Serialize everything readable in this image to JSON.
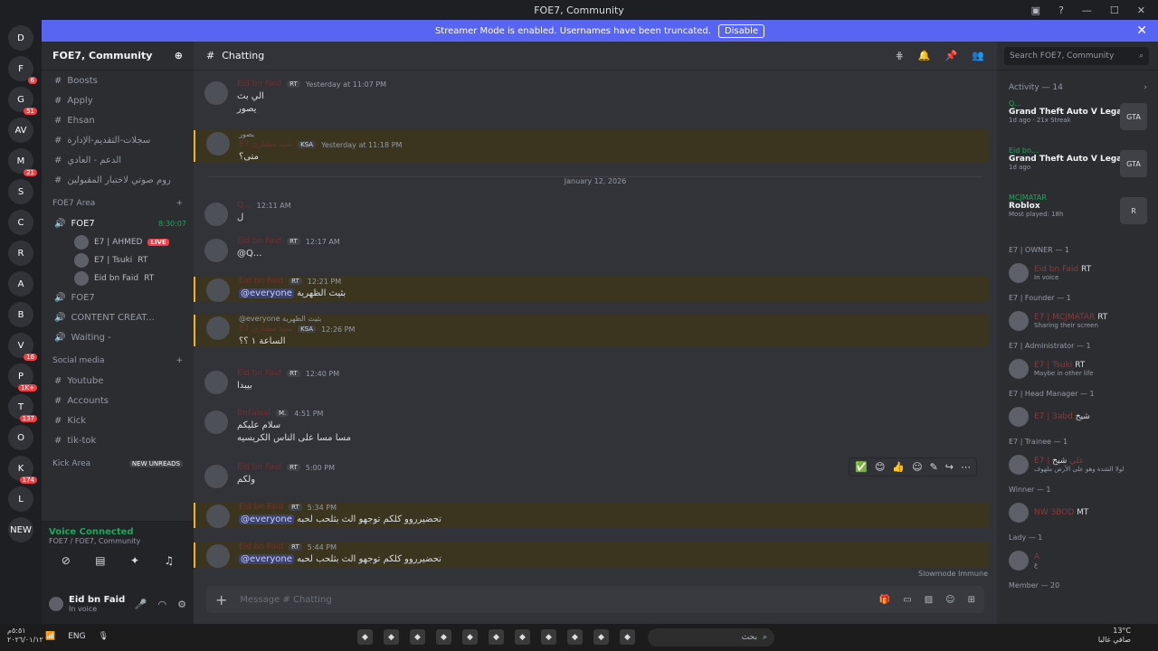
{
  "window": {
    "title": "FOE7, Community"
  },
  "banner": {
    "text": "Streamer Mode is enabled. Usernames have been truncated.",
    "button": "Disable"
  },
  "guild_rail": [
    {
      "label": "D"
    },
    {
      "label": "F",
      "badge": "6"
    },
    {
      "label": "G",
      "badge": "51"
    },
    {
      "label": "AV"
    },
    {
      "label": "M",
      "badge": "21"
    },
    {
      "label": "S"
    },
    {
      "label": "C"
    },
    {
      "label": "R"
    },
    {
      "label": "A"
    },
    {
      "label": "B"
    },
    {
      "label": "V",
      "badge": "16"
    },
    {
      "label": "P",
      "badge": "1K+"
    },
    {
      "label": "T",
      "badge": "137"
    },
    {
      "label": "O"
    },
    {
      "label": "K",
      "badge": "174"
    },
    {
      "label": "L"
    },
    {
      "label": "NEW"
    }
  ],
  "server": {
    "name": "FOE7, Community"
  },
  "channels": [
    {
      "name": "Boosts"
    },
    {
      "name": "Apply"
    },
    {
      "name": "Ehsan"
    },
    {
      "name": "سجلات-التقديم-الإدارة"
    },
    {
      "name": "الدعم - العادي"
    },
    {
      "name": "روم صوتي لاختبار المقبولين"
    }
  ],
  "foe7_area": {
    "label": "FOE7 Area",
    "voice": "FOE7",
    "timer": "8:30:07",
    "users": [
      {
        "name": "E7 | AHMED",
        "live": "LIVE"
      },
      {
        "name": "E7 | Tsuki",
        "tag": "RT"
      },
      {
        "name": "Eid bn Faid",
        "tag": "RT"
      }
    ],
    "more": [
      {
        "name": "FOE7"
      },
      {
        "name": "CONTENT CREAT..."
      },
      {
        "name": "Waiting -"
      }
    ]
  },
  "social": {
    "label": "Social media",
    "items": [
      {
        "name": "Youtube"
      },
      {
        "name": "Accounts"
      },
      {
        "name": "Kick"
      },
      {
        "name": "tik-tok"
      }
    ]
  },
  "kick_area": {
    "label": "Kick Area",
    "pill": "NEW UNREADS"
  },
  "voice": {
    "status": "Voice Connected",
    "where": "FOE7 / FOE7, Community"
  },
  "user": {
    "name": "Eid bn Faid",
    "status": "In voice"
  },
  "chat": {
    "channel": "Chatting",
    "search": "Search FOE7, Community",
    "divider": "January 12, 2026",
    "messages": [
      {
        "name": "Eid bn Faid",
        "tag": "RT",
        "time": "Yesterday at 11:07 PM",
        "lines": [
          "الي بث",
          "يصور"
        ]
      },
      {
        "reply": "يصور",
        "name": "E7 سيد مشاري",
        "tag": "KSA",
        "time": "Yesterday at 11:18 PM",
        "lines": [
          "متى؟"
        ]
      },
      {
        "name": "Q...",
        "tag": "",
        "time": "12:11 AM",
        "lines": [
          "ل"
        ]
      },
      {
        "name": "Eid bn Faid",
        "tag": "RT",
        "time": "12:17 AM",
        "lines": [
          "@Q..."
        ]
      },
      {
        "name": "Eid bn Faid",
        "tag": "RT",
        "time": "12:21 PM",
        "mention": "@everyone",
        "lines": [
          "بثيث الظهرية"
        ]
      },
      {
        "reply": "@everyone بثيث الظهرية",
        "name": "E7 سيد مشاري",
        "tag": "KSA",
        "time": "12:26 PM",
        "lines": [
          "الساعة ١ ؟؟"
        ]
      },
      {
        "name": "Eid bn Faid",
        "tag": "RT",
        "time": "12:40 PM",
        "lines": [
          "بيبدا"
        ]
      },
      {
        "name": "BnFaisal",
        "tag": "M.",
        "time": "4:51 PM",
        "lines": [
          "سلام عليكم",
          "مسا مسا على الناس الكريسيه"
        ]
      },
      {
        "name": "Eid bn Faid",
        "tag": "RT",
        "time": "5:00 PM",
        "lines": [
          "ولكم"
        ]
      },
      {
        "name": "Eid bn Faid",
        "tag": "RT",
        "time": "5:34 PM",
        "mention": "@everyone",
        "lines": [
          "تحضيرروو كلكم توجهو الث بثلحب لحبه"
        ]
      },
      {
        "name": "Eid bn Faid",
        "tag": "RT",
        "time": "5:44 PM",
        "mention": "@everyone",
        "lines": [
          "تحضيرروو كلكم توجهو الث بثلحب لحبه"
        ]
      }
    ],
    "slowmode": "Slowmode Immune",
    "input_placeholder": "Message #",
    "input_channel": "Chatting"
  },
  "activity": {
    "label": "Activity — 14",
    "items": [
      {
        "user": "Q...",
        "game": "Grand Theft Auto V Legacy",
        "detail": "1d ago · 21x Streak",
        "pic": "GTA"
      },
      {
        "user": "Eid bn...",
        "game": "Grand Theft Auto V Legacy",
        "detail": "1d ago",
        "pic": "GTA"
      },
      {
        "user": "MCJMATAR",
        "game": "Roblox",
        "detail": "Most played: 18h",
        "pic": "R"
      }
    ]
  },
  "roles": [
    {
      "role": "E7 | OWNER — 1",
      "member": "Eid bn Faid",
      "tag": "RT",
      "status": "In voice"
    },
    {
      "role": "E7 | Founder — 1",
      "member": "E7 | MCJMATAR",
      "tag": "RT",
      "status": "Sharing their screen"
    },
    {
      "role": "E7 | Administrator — 1",
      "member": "E7 | Tsuki",
      "tag": "RT",
      "status": "Maybe in other life"
    },
    {
      "role": "E7 | Head Manager — 1",
      "member": "E7 | 3abd",
      "tag": "شيخ",
      "status": ""
    },
    {
      "role": "E7 | Trainee — 1",
      "member": "E7 | علي",
      "tag": "شيخ",
      "status": "لولا الشدة وهو على الأرض ملهوف"
    },
    {
      "role": "Winner — 1",
      "member": "NW 3BOD",
      "tag": "MT",
      "status": ""
    },
    {
      "role": "Lady — 1",
      "member": "A",
      "tag": "",
      "status": "ع"
    },
    {
      "role": "Member — 20",
      "member": "",
      "tag": "",
      "status": ""
    }
  ],
  "taskbar": {
    "time": "٥:٥١م",
    "date": "٢٠٢٦/٠١/١٢",
    "lang": "ENG",
    "search": "بحث",
    "weather": "13°C",
    "weather_text": "صافي غالبا"
  }
}
